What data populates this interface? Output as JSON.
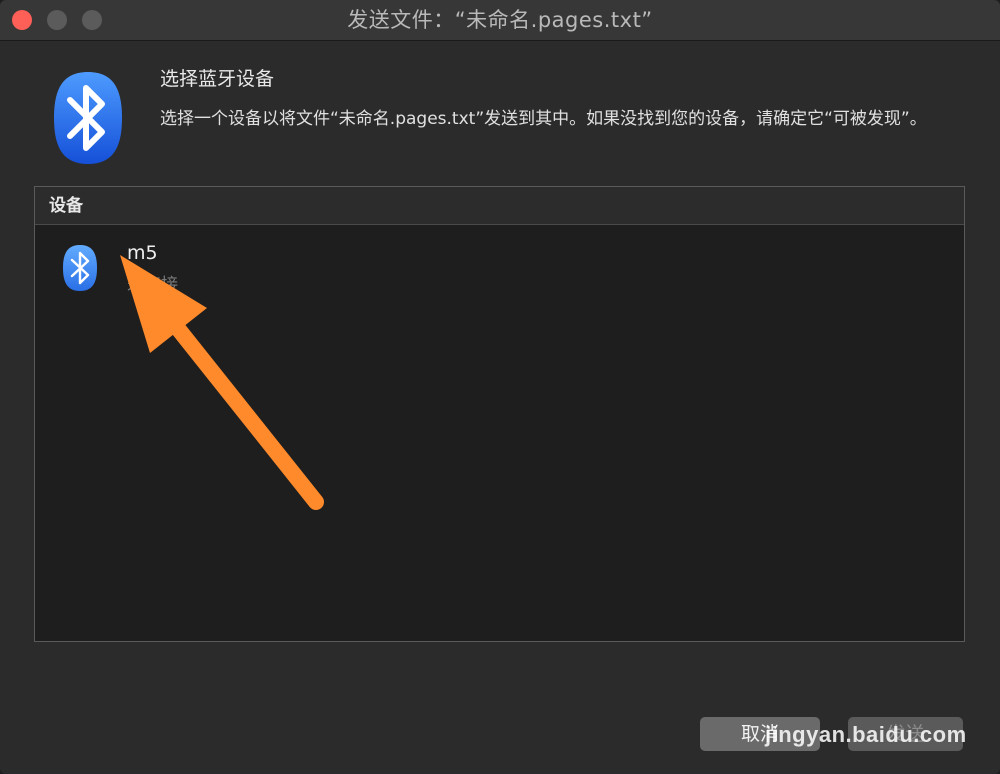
{
  "window": {
    "title": "发送文件：“未命名.pages.txt”"
  },
  "dialog": {
    "heading": "选择蓝牙设备",
    "description": "选择一个设备以将文件“未命名.pages.txt”发送到其中。如果没找到您的设备，请确定它“可被发现”。",
    "icon": "bluetooth-icon"
  },
  "device_list": {
    "header": "设备",
    "devices": [
      {
        "name": "m5",
        "status": "未连接",
        "icon": "bluetooth-icon"
      }
    ]
  },
  "buttons": {
    "cancel_label": "取消",
    "send_label": "发送"
  },
  "watermark": {
    "text": "jingyan.baidu.com"
  },
  "colors": {
    "close": "#fe5f57",
    "accent_arrow": "#ff8a2b",
    "bluetooth": "#2f7df0"
  }
}
